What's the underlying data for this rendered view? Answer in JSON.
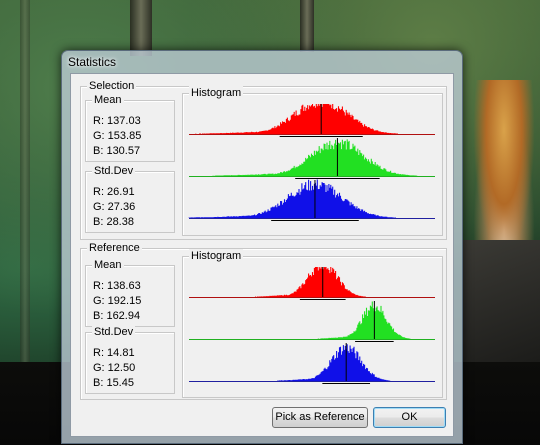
{
  "window": {
    "title": "Statistics"
  },
  "selection": {
    "label": "Selection",
    "mean": {
      "label": "Mean",
      "r": "R: 137.03",
      "g": "G: 153.85",
      "b": "B: 130.57"
    },
    "std": {
      "label": "Std.Dev",
      "r": "R: 26.91",
      "g": "G: 27.36",
      "b": "B: 28.38"
    },
    "histogram": {
      "label": "Histogram",
      "channels": [
        {
          "channel": "red",
          "color": "#ff0000",
          "axis_color": "#b01010",
          "mean": 137.03,
          "std": 26.91
        },
        {
          "channel": "green",
          "color": "#22e022",
          "axis_color": "#20b020",
          "mean": 153.85,
          "std": 27.36
        },
        {
          "channel": "blue",
          "color": "#1010e8",
          "axis_color": "#2020a0",
          "mean": 130.57,
          "std": 28.38
        }
      ]
    }
  },
  "reference": {
    "label": "Reference",
    "mean": {
      "label": "Mean",
      "r": "R: 138.63",
      "g": "G: 192.15",
      "b": "B: 162.94"
    },
    "std": {
      "label": "Std.Dev",
      "r": "R: 14.81",
      "g": "G: 12.50",
      "b": "B: 15.45"
    },
    "histogram": {
      "label": "Histogram",
      "channels": [
        {
          "channel": "red",
          "color": "#ff0000",
          "axis_color": "#b01010",
          "mean": 138.63,
          "std": 14.81
        },
        {
          "channel": "green",
          "color": "#22e022",
          "axis_color": "#20b020",
          "mean": 192.15,
          "std": 12.5
        },
        {
          "channel": "blue",
          "color": "#1010e8",
          "axis_color": "#2020a0",
          "mean": 162.94,
          "std": 15.45
        }
      ]
    }
  },
  "buttons": {
    "pick_reference": "Pick as Reference",
    "ok": "OK"
  }
}
